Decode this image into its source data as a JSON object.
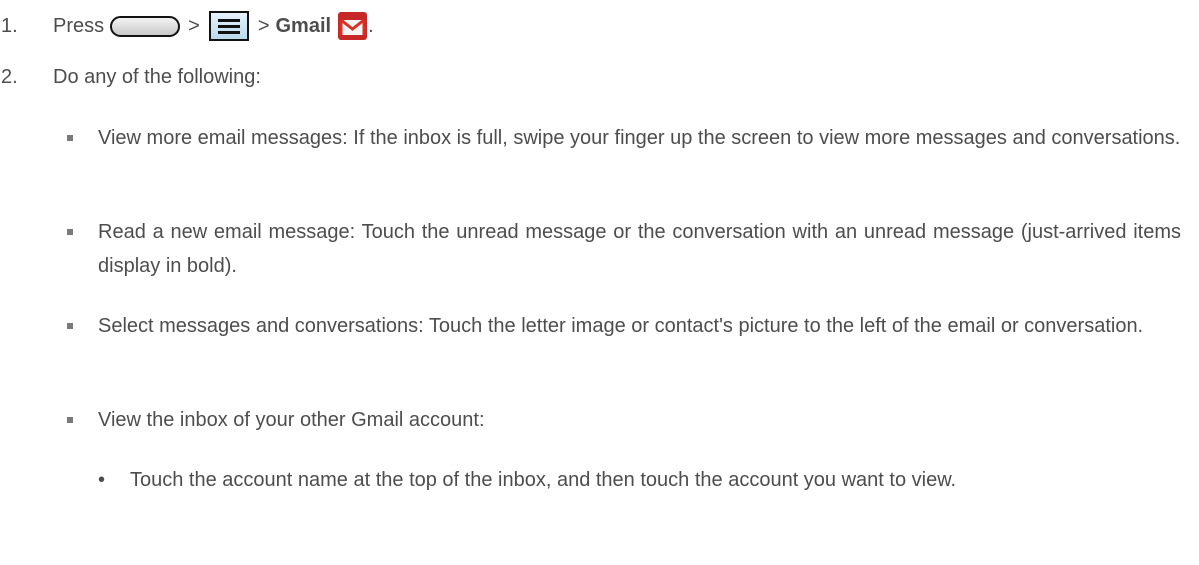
{
  "step1": {
    "number": "1.",
    "press": "Press",
    "sep1": ">",
    "sep2": ">",
    "target": "Gmail",
    "end": ".",
    "home_key_icon": "home-key-icon",
    "menu_key_icon": "menu-key-icon",
    "gmail_icon": "gmail-icon"
  },
  "step2": {
    "number": "2.",
    "text": "Do any of the following:"
  },
  "bullets": [
    "View more email messages: If the inbox is full, swipe your finger up the screen to view more messages and conversations.",
    "Read a new email message: Touch the unread message or the conversation with an unread message (just-arrived items display in bold).",
    "Select messages and conversations: Touch the letter image or contact's picture to the left of the email or conversation.",
    "View the inbox of your other Gmail account:"
  ],
  "sub_bullets": [
    {
      "marker": "•",
      "text": "Touch the account name at the top of the inbox, and then touch the account you want to view."
    }
  ],
  "colors": {
    "text": "#4d4d4d",
    "gmail_red": "#d93025"
  }
}
